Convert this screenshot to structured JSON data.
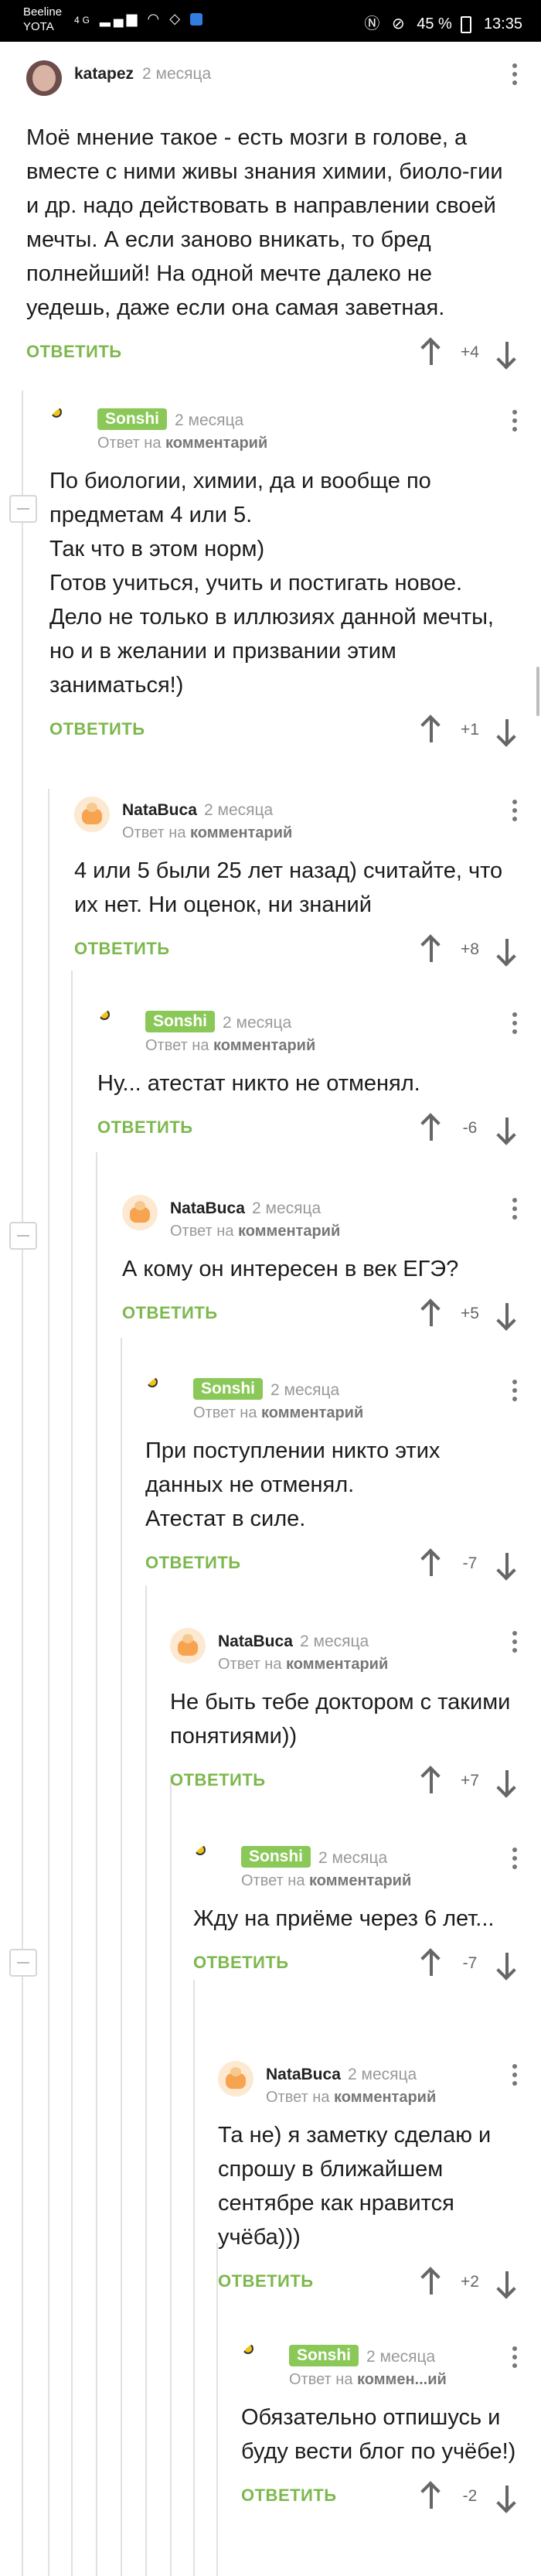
{
  "status_bar": {
    "carrier1": "Beeline",
    "carrier2": "YOTA",
    "network": "4G",
    "battery": "45 %",
    "time": "13:35"
  },
  "ui": {
    "reply_label": "ОТВЕТИТЬ",
    "reply_to_prefix": "Ответ на",
    "reply_to_link": "комментарий",
    "reply_to_link_short": "коммен...ий"
  },
  "comments": [
    {
      "author": "katapez",
      "time": "2 месяца",
      "text": "Моё мнение такое - есть мозги в голове, а вместе с ними живы знания химии, биоло-гии и др. надо действовать в направлении своей мечты. А если заново вникать, то бред полнейший! На одной мечте далеко не уедешь, даже если она самая заветная.",
      "score": "+4"
    },
    {
      "author": "Sonshi",
      "time": "2 месяца",
      "text": "По биологии, химии, да и вообще по предметам 4 или 5.\nТак что в этом норм)\nГотов учиться, учить и постигать новое.\nДело не только в иллюзиях данной мечты, но и в желании и призвании этим заниматься!)",
      "score": "+1"
    },
    {
      "author": "NataBuca",
      "time": "2 месяца",
      "text": "4 или 5 были 25 лет назад) считайте, что их нет. Ни оценок, ни знаний",
      "score": "+8"
    },
    {
      "author": "Sonshi",
      "time": "2 месяца",
      "text": "Ну... атестат никто не отменял.",
      "score": "-6"
    },
    {
      "author": "NataBuca",
      "time": "2 месяца",
      "text": "А кому он интересен в век ЕГЭ?",
      "score": "+5"
    },
    {
      "author": "Sonshi",
      "time": "2 месяца",
      "text": "При поступлении никто этих данных не отменял.\nАтестат в силе.",
      "score": "-7"
    },
    {
      "author": "NataBuca",
      "time": "2 месяца",
      "text": "Не быть тебе доктором с такими понятиями))",
      "score": "+7"
    },
    {
      "author": "Sonshi",
      "time": "2 месяца",
      "text": "Жду на приёме через 6 лет...",
      "score": "-7"
    },
    {
      "author": "NataBuca",
      "time": "2 месяца",
      "text": "Та не) я заметку сделаю и спрошу в ближайшем сентябре как нравится учёба)))",
      "score": "+2"
    },
    {
      "author": "Sonshi",
      "time": "2 месяца",
      "text": "Обязательно отпишусь и буду вести блог по учёбе!)",
      "score": "-2"
    }
  ]
}
